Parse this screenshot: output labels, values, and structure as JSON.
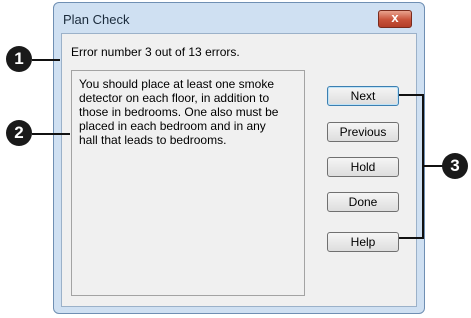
{
  "window": {
    "title": "Plan Check",
    "close_glyph": "x"
  },
  "status_line": "Error number 3 out of 13 errors.",
  "message": "You should place at least one smoke detector on each floor, in addition to those in bedrooms. One also must be placed in each bedroom and in any hall that leads to bedrooms.",
  "buttons": {
    "next": "Next",
    "previous": "Previous",
    "hold": "Hold",
    "done": "Done",
    "help": "Help"
  },
  "callouts": [
    "1",
    "2",
    "3"
  ]
}
